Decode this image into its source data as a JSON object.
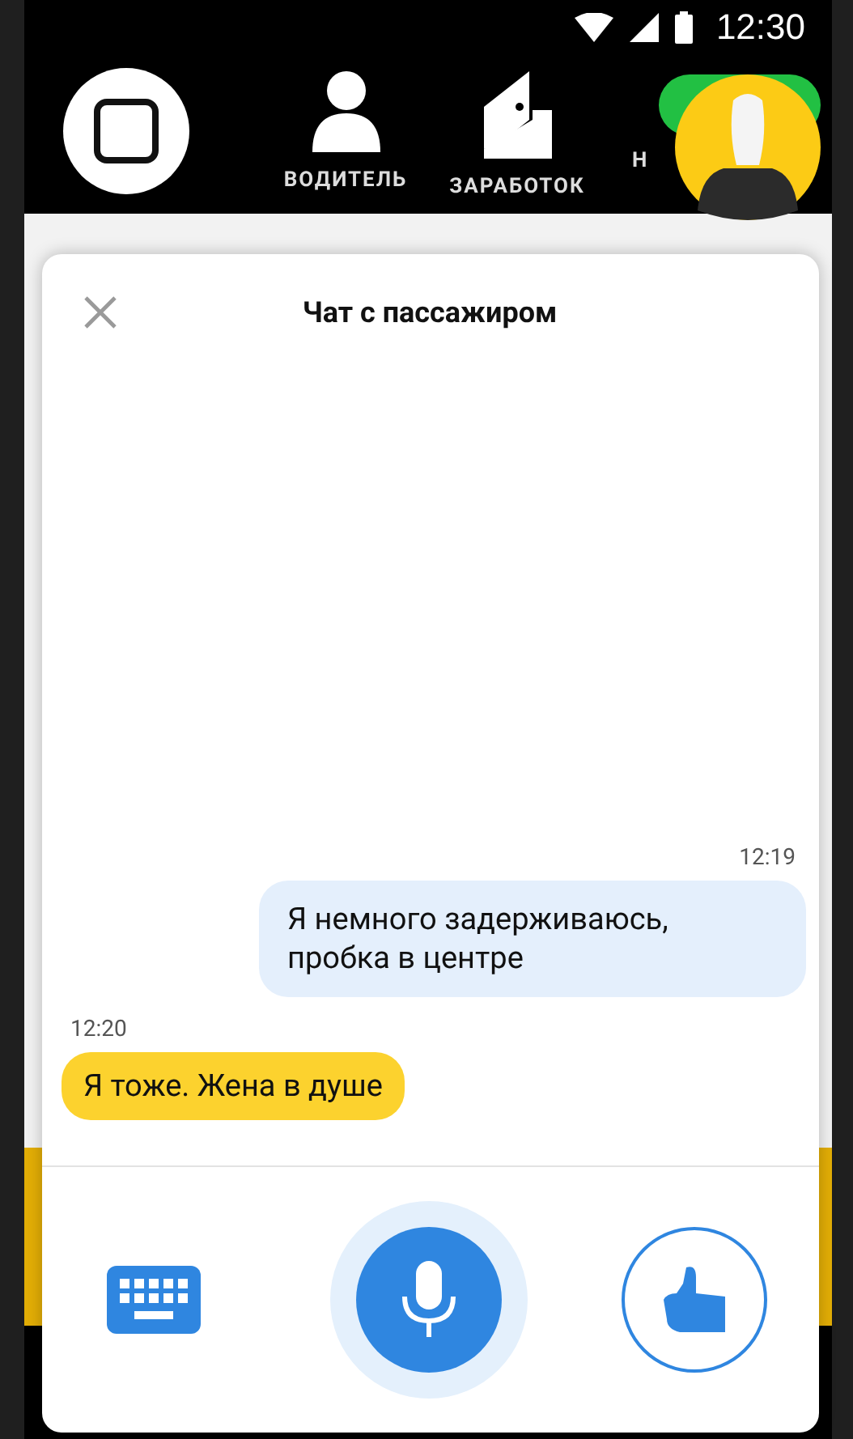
{
  "status_bar": {
    "time": "12:30"
  },
  "nav": {
    "items": [
      {
        "kind": "record"
      },
      {
        "kind": "person",
        "label": "ВОДИТЕЛЬ"
      },
      {
        "kind": "wallet",
        "label": "ЗАРАБОТОК"
      },
      {
        "kind": "status",
        "label": "Н"
      }
    ]
  },
  "chat": {
    "title": "Чат с пассажиром",
    "messages": [
      {
        "kind": "outgoing",
        "time": "12:19",
        "text": "Я немного задерживаюсь, пробка в центре"
      },
      {
        "kind": "incoming",
        "time": "12:20",
        "text": "Я тоже. Жена в душе"
      }
    ]
  }
}
